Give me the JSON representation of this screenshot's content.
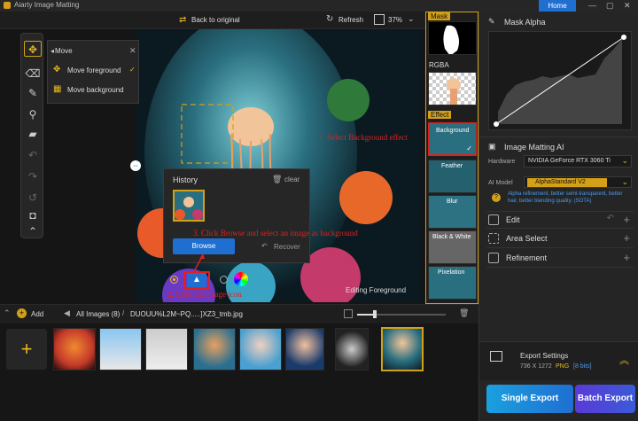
{
  "app": {
    "title": "Aiarty Image Matting",
    "home_label": "Home",
    "min": "—",
    "max": "▢",
    "close": "✕"
  },
  "topbar": {
    "back_label": "Back to original",
    "refresh_label": "Refresh",
    "zoom": "37%"
  },
  "move_menu": {
    "title": "Move",
    "items": [
      {
        "label": "Move foreground",
        "checked": true
      },
      {
        "label": "Move background",
        "checked": false
      }
    ]
  },
  "canvas": {
    "status_label": "Editing Foreground"
  },
  "history": {
    "title": "History",
    "clear_label": "clear",
    "browse_label": "Browse",
    "recover_label": "Recover"
  },
  "annotations": {
    "step1": "1. Select Background effect",
    "step2": "2. Click the image icon",
    "step3": "3. Click Browse and select an image as background"
  },
  "strip": {
    "mask_label": "Mask",
    "rgba_label": "RGBA",
    "effect_label": "Effect",
    "effects": [
      "Background",
      "Feather",
      "Blur",
      "Black & White",
      "Pixelation"
    ]
  },
  "right_panel": {
    "mask_alpha_title": "Mask Alpha",
    "matting_title": "Image Matting AI",
    "hardware_label": "Hardware",
    "hardware_value": "NVIDIA GeForce RTX 3060 Ti",
    "model_label": "AI Model",
    "model_value": "AlphaStandard  V2",
    "model_desc": "Alpha refinement, better semi-transparent, better hair, better blending quality. (SOTA)",
    "edit_label": "Edit",
    "area_select_label": "Area Select",
    "refinement_label": "Refinement",
    "export_title": "Export Settings",
    "export_size": "736 X 1272",
    "export_format": "PNG",
    "export_bits": "[8 bits]",
    "single_export": "Single Export",
    "batch_export": "Batch Export"
  },
  "bottombar": {
    "add_label": "Add",
    "all_images": "All Images (8)",
    "path": "DUOUU%L2M~PQ.....]XZ3_tmb.jpg"
  },
  "colors": {
    "accent": "#d4a017",
    "blue": "#1f6fd1",
    "annotation": "#e02020"
  }
}
